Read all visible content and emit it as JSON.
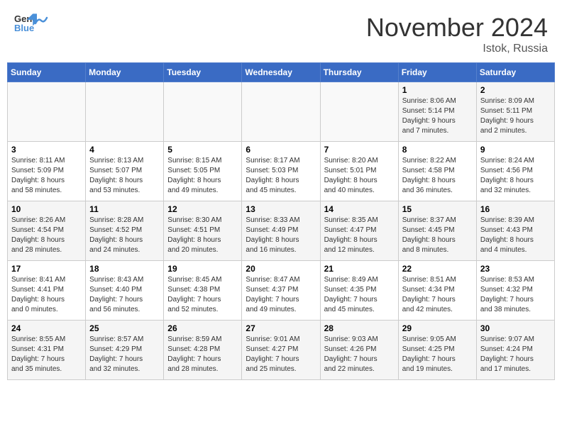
{
  "header": {
    "logo_general": "General",
    "logo_blue": "Blue",
    "month_title": "November 2024",
    "location": "Istok, Russia"
  },
  "weekdays": [
    "Sunday",
    "Monday",
    "Tuesday",
    "Wednesday",
    "Thursday",
    "Friday",
    "Saturday"
  ],
  "weeks": [
    [
      {
        "day": "",
        "info": ""
      },
      {
        "day": "",
        "info": ""
      },
      {
        "day": "",
        "info": ""
      },
      {
        "day": "",
        "info": ""
      },
      {
        "day": "",
        "info": ""
      },
      {
        "day": "1",
        "info": "Sunrise: 8:06 AM\nSunset: 5:14 PM\nDaylight: 9 hours\nand 7 minutes."
      },
      {
        "day": "2",
        "info": "Sunrise: 8:09 AM\nSunset: 5:11 PM\nDaylight: 9 hours\nand 2 minutes."
      }
    ],
    [
      {
        "day": "3",
        "info": "Sunrise: 8:11 AM\nSunset: 5:09 PM\nDaylight: 8 hours\nand 58 minutes."
      },
      {
        "day": "4",
        "info": "Sunrise: 8:13 AM\nSunset: 5:07 PM\nDaylight: 8 hours\nand 53 minutes."
      },
      {
        "day": "5",
        "info": "Sunrise: 8:15 AM\nSunset: 5:05 PM\nDaylight: 8 hours\nand 49 minutes."
      },
      {
        "day": "6",
        "info": "Sunrise: 8:17 AM\nSunset: 5:03 PM\nDaylight: 8 hours\nand 45 minutes."
      },
      {
        "day": "7",
        "info": "Sunrise: 8:20 AM\nSunset: 5:01 PM\nDaylight: 8 hours\nand 40 minutes."
      },
      {
        "day": "8",
        "info": "Sunrise: 8:22 AM\nSunset: 4:58 PM\nDaylight: 8 hours\nand 36 minutes."
      },
      {
        "day": "9",
        "info": "Sunrise: 8:24 AM\nSunset: 4:56 PM\nDaylight: 8 hours\nand 32 minutes."
      }
    ],
    [
      {
        "day": "10",
        "info": "Sunrise: 8:26 AM\nSunset: 4:54 PM\nDaylight: 8 hours\nand 28 minutes."
      },
      {
        "day": "11",
        "info": "Sunrise: 8:28 AM\nSunset: 4:52 PM\nDaylight: 8 hours\nand 24 minutes."
      },
      {
        "day": "12",
        "info": "Sunrise: 8:30 AM\nSunset: 4:51 PM\nDaylight: 8 hours\nand 20 minutes."
      },
      {
        "day": "13",
        "info": "Sunrise: 8:33 AM\nSunset: 4:49 PM\nDaylight: 8 hours\nand 16 minutes."
      },
      {
        "day": "14",
        "info": "Sunrise: 8:35 AM\nSunset: 4:47 PM\nDaylight: 8 hours\nand 12 minutes."
      },
      {
        "day": "15",
        "info": "Sunrise: 8:37 AM\nSunset: 4:45 PM\nDaylight: 8 hours\nand 8 minutes."
      },
      {
        "day": "16",
        "info": "Sunrise: 8:39 AM\nSunset: 4:43 PM\nDaylight: 8 hours\nand 4 minutes."
      }
    ],
    [
      {
        "day": "17",
        "info": "Sunrise: 8:41 AM\nSunset: 4:41 PM\nDaylight: 8 hours\nand 0 minutes."
      },
      {
        "day": "18",
        "info": "Sunrise: 8:43 AM\nSunset: 4:40 PM\nDaylight: 7 hours\nand 56 minutes."
      },
      {
        "day": "19",
        "info": "Sunrise: 8:45 AM\nSunset: 4:38 PM\nDaylight: 7 hours\nand 52 minutes."
      },
      {
        "day": "20",
        "info": "Sunrise: 8:47 AM\nSunset: 4:37 PM\nDaylight: 7 hours\nand 49 minutes."
      },
      {
        "day": "21",
        "info": "Sunrise: 8:49 AM\nSunset: 4:35 PM\nDaylight: 7 hours\nand 45 minutes."
      },
      {
        "day": "22",
        "info": "Sunrise: 8:51 AM\nSunset: 4:34 PM\nDaylight: 7 hours\nand 42 minutes."
      },
      {
        "day": "23",
        "info": "Sunrise: 8:53 AM\nSunset: 4:32 PM\nDaylight: 7 hours\nand 38 minutes."
      }
    ],
    [
      {
        "day": "24",
        "info": "Sunrise: 8:55 AM\nSunset: 4:31 PM\nDaylight: 7 hours\nand 35 minutes."
      },
      {
        "day": "25",
        "info": "Sunrise: 8:57 AM\nSunset: 4:29 PM\nDaylight: 7 hours\nand 32 minutes."
      },
      {
        "day": "26",
        "info": "Sunrise: 8:59 AM\nSunset: 4:28 PM\nDaylight: 7 hours\nand 28 minutes."
      },
      {
        "day": "27",
        "info": "Sunrise: 9:01 AM\nSunset: 4:27 PM\nDaylight: 7 hours\nand 25 minutes."
      },
      {
        "day": "28",
        "info": "Sunrise: 9:03 AM\nSunset: 4:26 PM\nDaylight: 7 hours\nand 22 minutes."
      },
      {
        "day": "29",
        "info": "Sunrise: 9:05 AM\nSunset: 4:25 PM\nDaylight: 7 hours\nand 19 minutes."
      },
      {
        "day": "30",
        "info": "Sunrise: 9:07 AM\nSunset: 4:24 PM\nDaylight: 7 hours\nand 17 minutes."
      }
    ]
  ]
}
